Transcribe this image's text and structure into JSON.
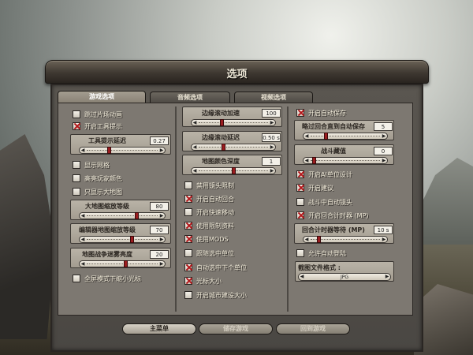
{
  "window": {
    "title": "选项"
  },
  "tabs": [
    {
      "label": "游戏选项",
      "active": true
    },
    {
      "label": "音频选项",
      "active": false
    },
    {
      "label": "视频选项",
      "active": false
    }
  ],
  "left": {
    "checks": [
      {
        "label": "跳过片场动画",
        "checked": false
      },
      {
        "label": "开启工具提示",
        "checked": true
      },
      {
        "label": "显示网格",
        "checked": false
      },
      {
        "label": "高亮玩家颜色",
        "checked": false
      },
      {
        "label": "只显示大地图",
        "checked": false
      },
      {
        "label": "全屏模式下缩小光标",
        "checked": false
      }
    ],
    "sliders": [
      {
        "label": "工具提示延迟",
        "value": "0.27",
        "level": 0.3
      },
      {
        "label": "大地图缩放等级",
        "value": "80",
        "level": 0.72
      },
      {
        "label": "编辑器地图缩放等级",
        "value": "70",
        "level": 0.65
      },
      {
        "label": "地图战争迷雾亮度",
        "value": "20",
        "level": 0.55
      }
    ]
  },
  "middle": {
    "sliders": [
      {
        "label": "边缘滚动加速",
        "value": "100",
        "level": 0.32
      },
      {
        "label": "边缘滚动延迟",
        "value": "0.50 s",
        "level": 0.35
      },
      {
        "label": "地图颜色深度",
        "value": "1",
        "level": 0.5
      }
    ],
    "checks": [
      {
        "label": "禁用镜头限制",
        "checked": false
      },
      {
        "label": "开启自动回合",
        "checked": true
      },
      {
        "label": "开启快速移动",
        "checked": false
      },
      {
        "label": "使用限制资料",
        "checked": true
      },
      {
        "label": "使用MODS",
        "checked": true
      },
      {
        "label": "跟随选中单位",
        "checked": false
      },
      {
        "label": "自动选中下个单位",
        "checked": true
      },
      {
        "label": "光标大小",
        "checked": true
      },
      {
        "label": "开启城市建设大小",
        "checked": false
      }
    ]
  },
  "right": {
    "checks_top": [
      {
        "label": "开启自动保存",
        "checked": true
      }
    ],
    "sliders_top": [
      {
        "label": "略过回合直到自动保存",
        "value": "5",
        "level": 0.2
      },
      {
        "label": "战斗藏值",
        "value": "0",
        "level": 0.02
      }
    ],
    "checks_mid": [
      {
        "label": "开启AI单位设计",
        "checked": true
      },
      {
        "label": "开启建议",
        "checked": true
      },
      {
        "label": "战斗中自动镜头",
        "checked": false
      },
      {
        "label": "开启回合计时器 (MP)",
        "checked": true
      }
    ],
    "sliders_mid": [
      {
        "label": "回合计时器等待 (MP)",
        "value": "10 s",
        "level": 0.1
      }
    ],
    "checks_bottom": [
      {
        "label": "允许自动登陆",
        "checked": false
      }
    ],
    "file_format": {
      "label": "截图文件格式 :",
      "value": "JPG"
    }
  },
  "buttons": {
    "main_menu": "主菜单",
    "save_game": "储存游戏",
    "return_game": "回到游戏"
  }
}
